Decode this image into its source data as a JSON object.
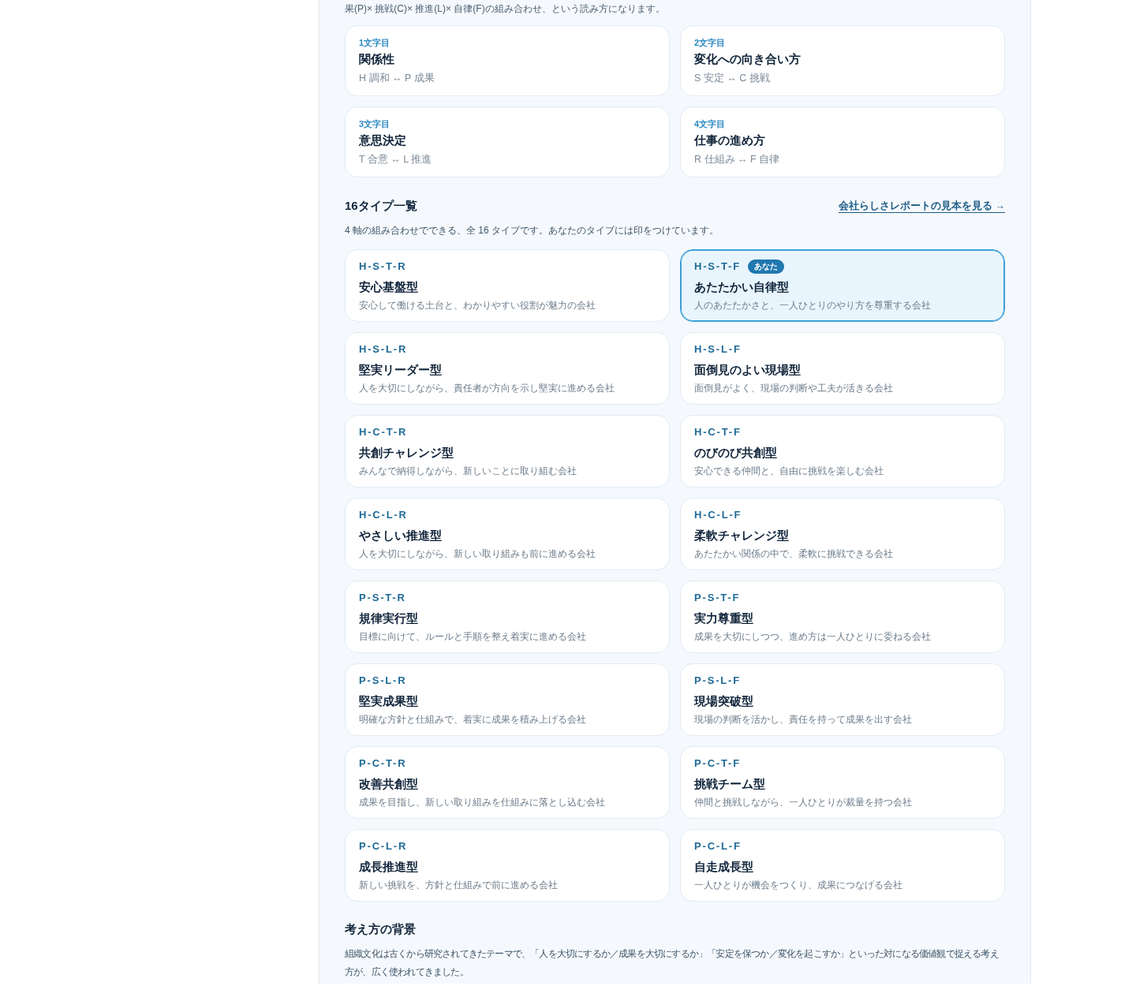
{
  "intro": {
    "text": "果(P)× 挑戦(C)× 推進(L)× 自律(F)の組み合わせ、という読み方になります。"
  },
  "axes": [
    {
      "position": "1文字目",
      "name": "関係性",
      "poles": "H 調和 ↔ P 成果"
    },
    {
      "position": "2文字目",
      "name": "変化への向き合い方",
      "poles": "S 安定 ↔ C 挑戦"
    },
    {
      "position": "3文字目",
      "name": "意思決定",
      "poles": "T 合意 ↔ L 推進"
    },
    {
      "position": "4文字目",
      "name": "仕事の進め方",
      "poles": "R 仕組み ↔ F 自律"
    }
  ],
  "types_section": {
    "title": "16タイプ一覧",
    "link": "会社らしさレポートの見本を見る →",
    "description": "4 軸の組み合わせでできる、全 16 タイプです。あなたのタイプには印をつけています。",
    "types": [
      {
        "code": "H-S-T-R",
        "name": "安心基盤型",
        "description": "安心して働ける土台と、わかりやすい役割が魅力の会社",
        "selected": false
      },
      {
        "code": "H-S-T-F",
        "name": "あたたかい自律型",
        "description": "人のあたたかさと、一人ひとりのやり方を尊重する会社",
        "selected": true,
        "badge": "あなた"
      },
      {
        "code": "H-S-L-R",
        "name": "堅実リーダー型",
        "description": "人を大切にしながら、責任者が方向を示し堅実に進める会社",
        "selected": false
      },
      {
        "code": "H-S-L-F",
        "name": "面倒見のよい現場型",
        "description": "面倒見がよく、現場の判断や工夫が活きる会社",
        "selected": false
      },
      {
        "code": "H-C-T-R",
        "name": "共創チャレンジ型",
        "description": "みんなで納得しながら、新しいことに取り組む会社",
        "selected": false
      },
      {
        "code": "H-C-T-F",
        "name": "のびのび共創型",
        "description": "安心できる仲間と、自由に挑戦を楽しむ会社",
        "selected": false
      },
      {
        "code": "H-C-L-R",
        "name": "やさしい推進型",
        "description": "人を大切にしながら、新しい取り組みも前に進める会社",
        "selected": false
      },
      {
        "code": "H-C-L-F",
        "name": "柔軟チャレンジ型",
        "description": "あたたかい関係の中で、柔軟に挑戦できる会社",
        "selected": false
      },
      {
        "code": "P-S-T-R",
        "name": "規律実行型",
        "description": "目標に向けて、ルールと手順を整え着実に進める会社",
        "selected": false
      },
      {
        "code": "P-S-T-F",
        "name": "実力尊重型",
        "description": "成果を大切にしつつ、進め方は一人ひとりに委ねる会社",
        "selected": false
      },
      {
        "code": "P-S-L-R",
        "name": "堅実成果型",
        "description": "明確な方針と仕組みで、着実に成果を積み上げる会社",
        "selected": false
      },
      {
        "code": "P-S-L-F",
        "name": "現場突破型",
        "description": "現場の判断を活かし、責任を持って成果を出す会社",
        "selected": false
      },
      {
        "code": "P-C-T-R",
        "name": "改善共創型",
        "description": "成果を目指し、新しい取り組みを仕組みに落とし込む会社",
        "selected": false
      },
      {
        "code": "P-C-T-F",
        "name": "挑戦チーム型",
        "description": "仲間と挑戦しながら、一人ひとりが裁量を持つ会社",
        "selected": false
      },
      {
        "code": "P-C-L-R",
        "name": "成長推進型",
        "description": "新しい挑戦を、方針と仕組みで前に進める会社",
        "selected": false
      },
      {
        "code": "P-C-L-F",
        "name": "自走成長型",
        "description": "一人ひとりが機会をつくり、成果につなげる会社",
        "selected": false
      }
    ]
  },
  "background_section": {
    "title": "考え方の背景",
    "text": "組織文化は古くから研究されてきたテーマで、「人を大切にするか／成果を大切にするか」「安定を保つか／変化を起こすか」といった対になる価値観で捉える考え方が、広く使われてきました。"
  }
}
